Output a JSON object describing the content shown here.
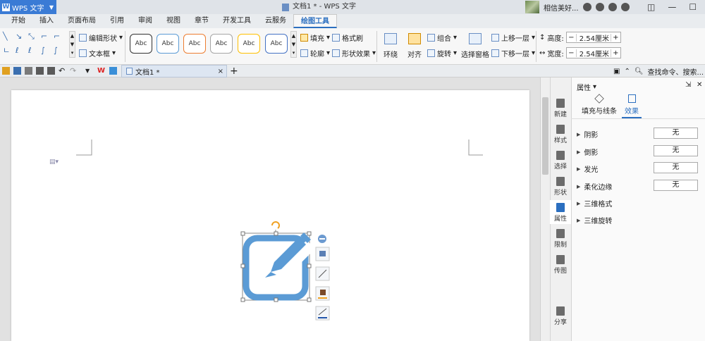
{
  "titlebar": {
    "app_name": "WPS 文字",
    "doc_title": "文档1 * - WPS 文字",
    "user_name": "相信美好..."
  },
  "menu": {
    "tabs": [
      "开始",
      "插入",
      "页面布局",
      "引用",
      "审阅",
      "视图",
      "章节",
      "开发工具",
      "云服务",
      "绘图工具"
    ],
    "active": "绘图工具"
  },
  "ribbon": {
    "edit_shape": "编辑形状",
    "text_box": "文本框",
    "style_label": "Abc",
    "fill": "填充",
    "format_brush": "格式刷",
    "outline": "轮廓",
    "shape_effect": "形状效果",
    "wrap": "环绕",
    "align": "对齐",
    "group": "组合",
    "rotate": "旋转",
    "selection_pane": "选择窗格",
    "bring_forward": "上移一层",
    "send_backward": "下移一层",
    "height_label": "高度:",
    "height_value": "2.54厘米",
    "width_label": "宽度:",
    "width_value": "2.54厘米"
  },
  "doctab": {
    "name": "文档1 *"
  },
  "search": {
    "placeholder": "查找命令、搜索..."
  },
  "sidebar": [
    "新建",
    "样式",
    "选择",
    "形状",
    "属性",
    "限制",
    "传图",
    "分享"
  ],
  "panel": {
    "title": "属性",
    "tab_fill": "填充与线条",
    "tab_effect": "效果",
    "rows": [
      {
        "label": "阴影",
        "value": "无"
      },
      {
        "label": "倒影",
        "value": "无"
      },
      {
        "label": "发光",
        "value": "无"
      },
      {
        "label": "柔化边缘",
        "value": "无"
      },
      {
        "label": "三维格式"
      },
      {
        "label": "三维旋转"
      }
    ]
  },
  "colors": {
    "accent": "#2b6fc0",
    "shape_blue": "#5b9bd5",
    "rotate_handle": "#f0a020"
  }
}
